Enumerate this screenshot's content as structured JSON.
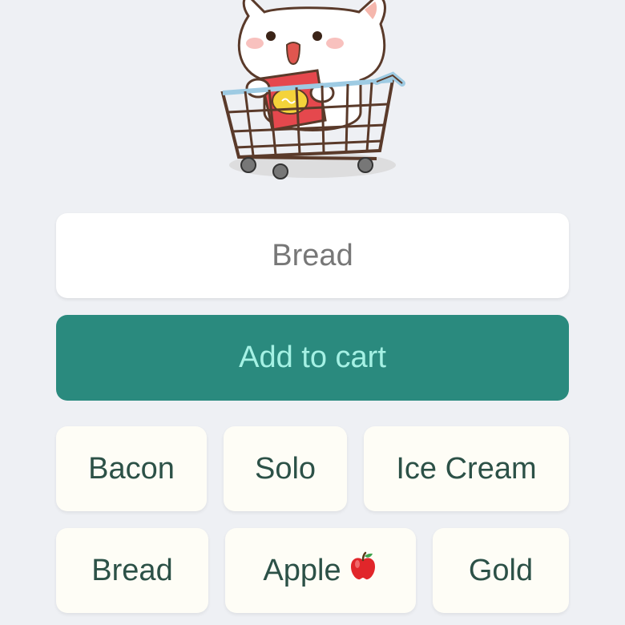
{
  "input": {
    "placeholder": "Bread",
    "value": ""
  },
  "add_button": {
    "label": "Add to cart"
  },
  "chips": [
    {
      "label": "Bacon"
    },
    {
      "label": "Solo"
    },
    {
      "label": "Ice Cream"
    },
    {
      "label": "Bread"
    },
    {
      "label": "Apple",
      "icon": "apple-icon"
    },
    {
      "label": "Gold"
    }
  ],
  "colors": {
    "background": "#eef0f4",
    "accent": "#2a8a7e",
    "accent_text": "#a5f1e4",
    "chip_bg": "#fefdf6",
    "chip_text": "#2c5147"
  },
  "hero": {
    "icon": "cat-in-shopping-cart-illustration"
  }
}
